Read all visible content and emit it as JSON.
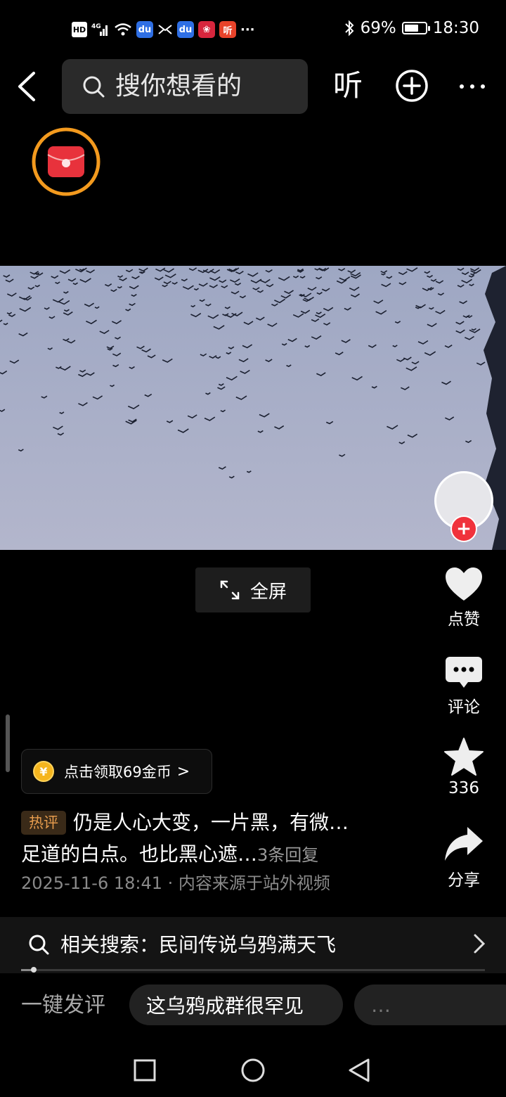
{
  "status_bar": {
    "left_icons": [
      "HD",
      "4G-signal-icon",
      "wifi-icon",
      "baidu-app-icon",
      "mail-icon",
      "baidu-app-icon",
      "gift-app-icon",
      "listen-app-icon",
      "more-dots-icon"
    ],
    "hd": "HD",
    "network": "4G",
    "battery_percent": "69%",
    "battery_level": 0.69,
    "time": "18:30",
    "overflow": "···"
  },
  "top_bar": {
    "search_placeholder": "搜你想看的",
    "listen_label": "听"
  },
  "video": {
    "fullscreen_label": "全屏",
    "sky_color": "#aab1cb"
  },
  "actions": {
    "like_label": "点赞",
    "comment_label": "评论",
    "favorite_count": "336",
    "share_label": "分享"
  },
  "coins": {
    "text": "点击领取69金币",
    "chevron": ">"
  },
  "hot_comment": {
    "badge": "热评",
    "line1": "仍是人心大变，一片黑，有微…",
    "line2": "足道的白点。也比黑心遮…",
    "replies": "3条回复",
    "meta": "2025-11-6 18:41 · 内容来源于站外视频"
  },
  "related_search": {
    "label": "相关搜索：民间传说乌鸦满天飞"
  },
  "quick_comment": {
    "label": "一键发评",
    "chips": [
      "这乌鸦成群很罕见",
      "…"
    ]
  },
  "colors": {
    "accent_red": "#f0323c",
    "ring_orange": "#f39a1e",
    "badge_orange": "#e59b4d"
  }
}
